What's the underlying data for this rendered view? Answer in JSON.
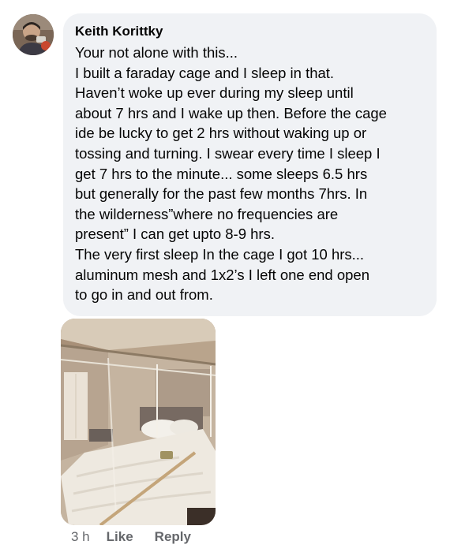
{
  "comment": {
    "author": "Keith Korittky",
    "lines": [
      "Your not alone with this...",
      "I built a faraday cage and I sleep in that.",
      "Haven’t woke up ever during my sleep until",
      "about 7 hrs and I wake up then. Before the cage",
      "ide be lucky to get 2 hrs without waking up or",
      "tossing and turning. I swear every time I sleep I",
      "get 7 hrs to the minute... some sleeps 6.5 hrs",
      "but generally for the past few months 7hrs. In",
      "the wilderness”where no frequencies are",
      "present” I can get upto 8-9 hrs.",
      "The very first sleep In the cage I got 10 hrs...",
      "aluminum mesh and 1x2’s I left one end open",
      "to go in and out from."
    ]
  },
  "actions": {
    "time": "3 h",
    "like": "Like",
    "reply": "Reply"
  },
  "colors": {
    "bubble_bg": "#f0f2f5",
    "meta_text": "#65676b"
  }
}
